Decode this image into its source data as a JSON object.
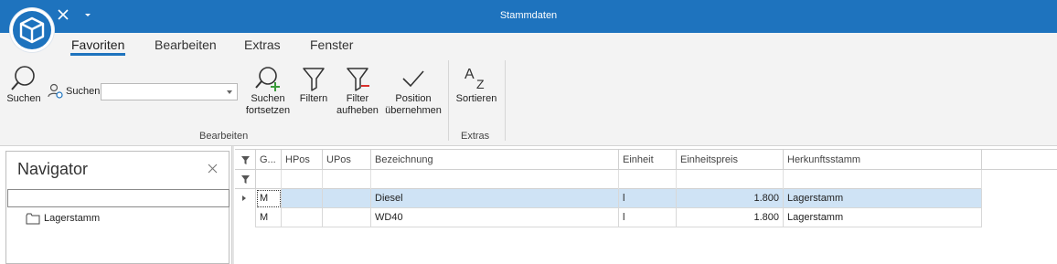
{
  "window": {
    "title": "Stammdaten"
  },
  "ribbon": {
    "tabs": [
      {
        "label": "Favoriten",
        "active": true
      },
      {
        "label": "Bearbeiten",
        "active": false
      },
      {
        "label": "Extras",
        "active": false
      },
      {
        "label": "Fenster",
        "active": false
      }
    ],
    "buttons": {
      "suchen": "Suchen",
      "suchen_small": "Suchen",
      "suchen_fortsetzen_1": "Suchen",
      "suchen_fortsetzen_2": "fortsetzen",
      "filtern": "Filtern",
      "filter_aufheben_1": "Filter",
      "filter_aufheben_2": "aufheben",
      "position_1": "Position",
      "position_2": "übernehmen",
      "sortieren": "Sortieren"
    },
    "search_value": "",
    "groups": {
      "bearbeiten": "Bearbeiten",
      "extras": "Extras"
    }
  },
  "navigator": {
    "title": "Navigator",
    "search_value": "",
    "items": [
      {
        "label": "Lagerstamm",
        "icon": "folder-icon"
      }
    ]
  },
  "grid": {
    "columns": [
      "G...",
      "HPos",
      "UPos",
      "Bezeichnung",
      "Einheit",
      "Einheitspreis",
      "Herkunftsstamm"
    ],
    "rows": [
      {
        "g": "M",
        "hpos": "",
        "upos": "",
        "bezeichnung": "Diesel",
        "einheit": "l",
        "einheitspreis": "1.800",
        "herkunftsstamm": "Lagerstamm",
        "selected": true
      },
      {
        "g": "M",
        "hpos": "",
        "upos": "",
        "bezeichnung": "WD40",
        "einheit": "l",
        "einheitspreis": "1.800",
        "herkunftsstamm": "Lagerstamm",
        "selected": false
      }
    ]
  },
  "colors": {
    "accent": "#1e73be",
    "selection": "#cfe3f5",
    "ribbon_bg": "#f3f3f3"
  }
}
